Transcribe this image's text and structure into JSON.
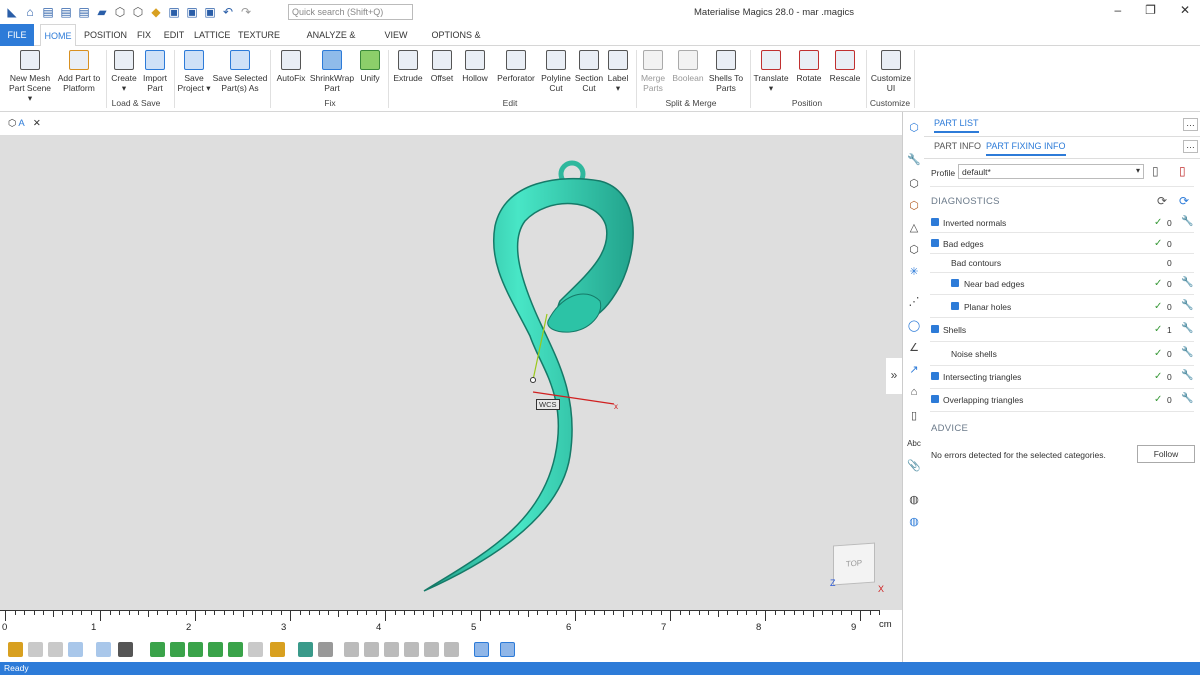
{
  "app": {
    "window_title": "Materialise Magics 28.0 - mar .magics",
    "search_placeholder": "Quick search (Shift+Q)",
    "status": "Ready"
  },
  "menu": [
    "FILE",
    "HOME",
    "POSITION",
    "FIX",
    "EDIT",
    "LATTICE",
    "TEXTURE",
    "ANALYZE & REPORT",
    "VIEW",
    "OPTIONS & HELP"
  ],
  "ribbon": {
    "buttons": [
      {
        "l1": "New Mesh",
        "l2": "Part Scene ▾"
      },
      {
        "l1": "Add Part to",
        "l2": "Platform"
      },
      {
        "l1": "Create",
        "l2": "▾"
      },
      {
        "l1": "Import",
        "l2": "Part"
      },
      {
        "l1": "Save",
        "l2": "Project ▾"
      },
      {
        "l1": "Save Selected",
        "l2": "Part(s) As"
      },
      {
        "l1": "AutoFix",
        "l2": ""
      },
      {
        "l1": "ShrinkWrap",
        "l2": "Part"
      },
      {
        "l1": "Unify",
        "l2": ""
      },
      {
        "l1": "Extrude",
        "l2": ""
      },
      {
        "l1": "Offset",
        "l2": ""
      },
      {
        "l1": "Hollow",
        "l2": ""
      },
      {
        "l1": "Perforator",
        "l2": ""
      },
      {
        "l1": "Polyline",
        "l2": "Cut"
      },
      {
        "l1": "Section",
        "l2": "Cut"
      },
      {
        "l1": "Label",
        "l2": "▾"
      },
      {
        "l1": "Merge",
        "l2": "Parts"
      },
      {
        "l1": "Boolean",
        "l2": ""
      },
      {
        "l1": "Shells To",
        "l2": "Parts"
      },
      {
        "l1": "Translate",
        "l2": "▾"
      },
      {
        "l1": "Rotate",
        "l2": ""
      },
      {
        "l1": "Rescale",
        "l2": ""
      },
      {
        "l1": "Customize",
        "l2": "UI"
      }
    ],
    "groups": [
      "Load & Save",
      "Fix",
      "Edit",
      "Split & Merge",
      "Position",
      "Customize"
    ]
  },
  "document_tab": "A",
  "viewport": {
    "wcs_label": "WCS",
    "cube_label": "TOP"
  },
  "ruler": {
    "ticks": [
      "0",
      "1",
      "2",
      "3",
      "4",
      "5",
      "6",
      "7",
      "8",
      "9"
    ],
    "unit": "cm"
  },
  "panel": {
    "tab_part_list": "PART LIST",
    "tab_part_info": "PART INFO",
    "tab_part_fixing": "PART FIXING INFO",
    "profile_label": "Profile",
    "profile_value": "default*",
    "diagnostics_title": "DIAGNOSTICS",
    "rows": [
      {
        "label": "Inverted normals",
        "count": "0",
        "check": "✓"
      },
      {
        "label": "Bad edges",
        "count": "0",
        "check": "✓"
      },
      {
        "label": "Bad contours",
        "count": "0",
        "check": ""
      },
      {
        "label": "Near bad edges",
        "count": "0",
        "check": "✓"
      },
      {
        "label": "Planar holes",
        "count": "0",
        "check": "✓"
      },
      {
        "label": "Shells",
        "count": "1",
        "check": "✓"
      },
      {
        "label": "Noise shells",
        "count": "0",
        "check": "✓"
      },
      {
        "label": "Intersecting triangles",
        "count": "0",
        "check": "✓"
      },
      {
        "label": "Overlapping triangles",
        "count": "0",
        "check": "✓"
      }
    ],
    "advice_title": "ADVICE",
    "advice_text": "No errors detected for the selected categories.",
    "follow_label": "Follow"
  },
  "colors": {
    "accent": "#2d7bd8",
    "model": "#3ed6b8"
  }
}
